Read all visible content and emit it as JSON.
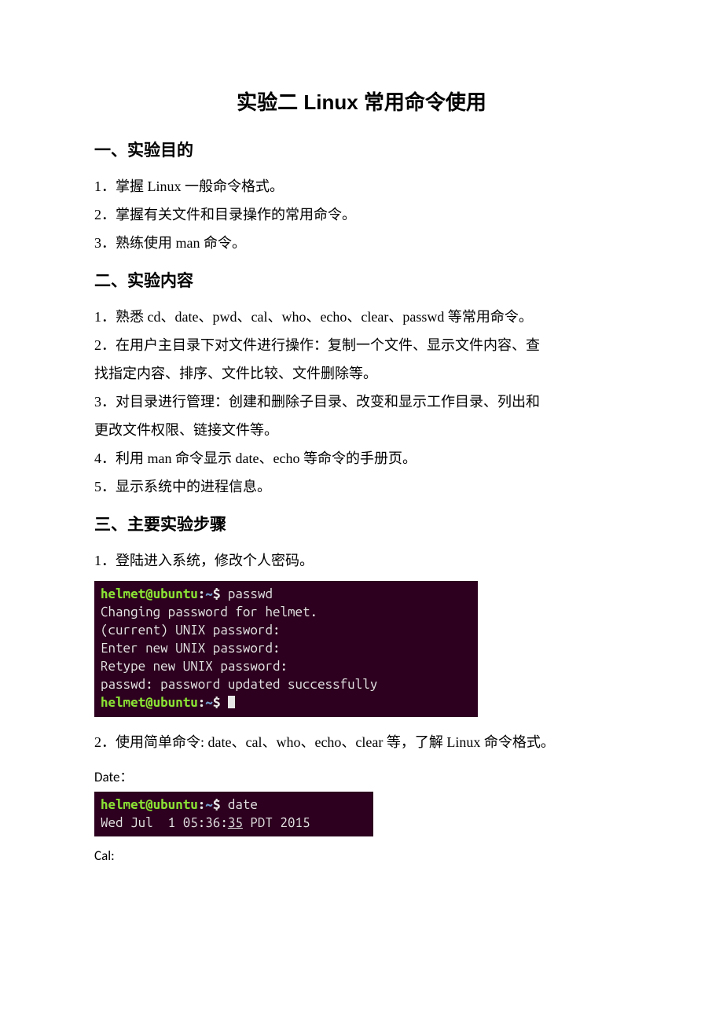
{
  "doc": {
    "title": "实验二  Linux 常用命令使用",
    "sec1": {
      "heading": "一、实验目的",
      "p1": "1．掌握 Linux 一般命令格式。",
      "p2": "2．掌握有关文件和目录操作的常用命令。",
      "p3": "3．熟练使用 man 命令。"
    },
    "sec2": {
      "heading": "二、实验内容",
      "p1": "1．熟悉 cd、date、pwd、cal、who、echo、clear、passwd 等常用命令。",
      "p2a": "2．在用户主目录下对文件进行操作：复制一个文件、显示文件内容、查",
      "p2b": "找指定内容、排序、文件比较、文件删除等。",
      "p3a": "3．对目录进行管理：创建和删除子目录、改变和显示工作目录、列出和",
      "p3b": "更改文件权限、链接文件等。",
      "p4": "4．利用 man 命令显示 date、echo 等命令的手册页。",
      "p5": "5．显示系统中的进程信息。"
    },
    "sec3": {
      "heading": "三、主要实验步骤",
      "p1": "1．登陆进入系统，修改个人密码。",
      "p2": "2．使用简单命令: date、cal、who、echo、clear 等，了解 Linux 命令格式。",
      "date_label": "Date：",
      "cal_label": "Cal:"
    },
    "term1": {
      "prompt_user": "helmet@ubuntu",
      "prompt_path": "~",
      "cmd1": "passwd",
      "out1": "Changing password for helmet.",
      "out2": "(current) UNIX password:",
      "out3": "Enter new UNIX password:",
      "out4": "Retype new UNIX password:",
      "out5": "passwd: password updated successfully"
    },
    "term2": {
      "prompt_user": "helmet@ubuntu",
      "prompt_path": "~",
      "cmd1": "date",
      "out1_a": "Wed Jul  1 05:36:",
      "out1_b": "35",
      "out1_c": " PDT 2015"
    }
  }
}
